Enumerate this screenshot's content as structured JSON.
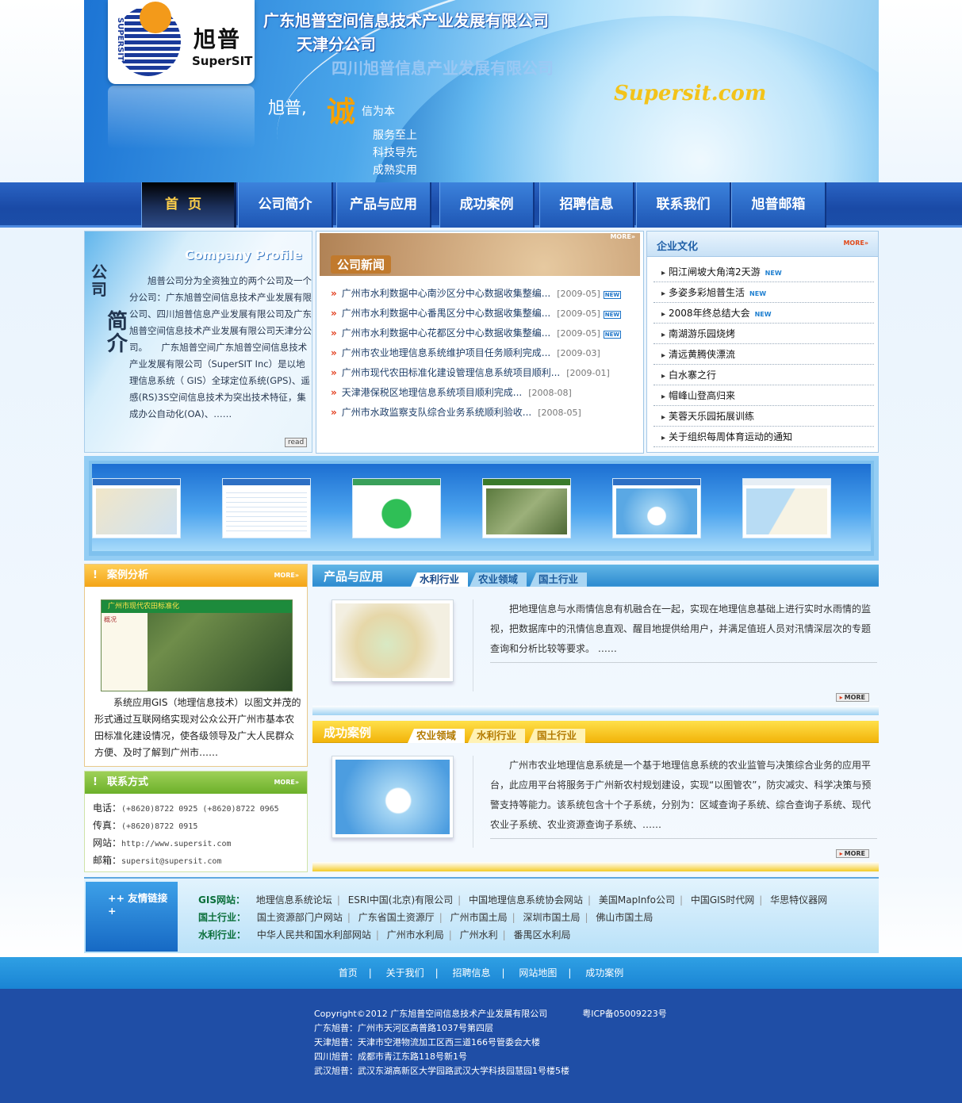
{
  "banner": {
    "company_cn1": "广东旭普空间信息技术产业发展有限公司",
    "company_cn2": "天津分公司",
    "company_cn3": "四川旭普信息产业发展有限公司",
    "logo_cn": "旭普",
    "logo_en": "SuperSIT",
    "logo_vertical": "SUPERSIT",
    "slogan_prefix": "旭普,",
    "slogan_big": "诚",
    "slogan_suffix": "信为本",
    "slogan_lines": [
      "服务至上",
      "科技导先",
      "成熟实用"
    ],
    "site": "Supersit.com"
  },
  "nav": {
    "items": [
      "首页",
      "公司简介",
      "产品与应用",
      "成功案例",
      "招聘信息",
      "联系我们",
      "旭普邮箱"
    ]
  },
  "profile": {
    "title_en": "Company Profile",
    "title_cn_small": "公司",
    "title_cn_big": "简介",
    "text": "　　旭普公司分为全资独立的两个公司及一个分公司：广东旭普空间信息技术产业发展有限公司、四川旭普信息产业发展有限公司及广东旭普空间信息技术产业发展有限公司天津分公司。　　广东旭普空间广东旭普空间信息技术产业发展有限公司（SuperSIT Inc）是以地理信息系统（ GIS）全球定位系统(GPS)、遥感(RS)3S空间信息技术为突出技术特征，集成办公自动化(OA)、……",
    "read_label": "read"
  },
  "news": {
    "title": "公司新闻",
    "more": "MORE»",
    "items": [
      {
        "title": "广州市水利数据中心南沙区分中心数据收集整编...",
        "date": "[2009-05]",
        "new": "NEW"
      },
      {
        "title": "广州市水利数据中心番禺区分中心数据收集整编...",
        "date": "[2009-05]",
        "new": "NEW"
      },
      {
        "title": "广州市水利数据中心花都区分中心数据收集整编...",
        "date": "[2009-05]",
        "new": "NEW"
      },
      {
        "title": "广州市农业地理信息系统维护项目任务顺利完成...",
        "date": "[2009-03]",
        "new": ""
      },
      {
        "title": "广州市现代农田标准化建设管理信息系统项目顺利...",
        "date": "[2009-01]",
        "new": ""
      },
      {
        "title": "天津港保税区地理信息系统项目顺利完成...",
        "date": "[2008-08]",
        "new": ""
      },
      {
        "title": "广州市水政监察支队综合业务系统顺利验收...",
        "date": "[2008-05]",
        "new": ""
      }
    ]
  },
  "culture": {
    "title": "企业文化",
    "more": "MORE»",
    "items": [
      {
        "title": "阳江闸坡大角湾2天游",
        "new": "NEW"
      },
      {
        "title": "多姿多彩旭普生活",
        "new": "NEW"
      },
      {
        "title": "2008年终总结大会",
        "new": "NEW"
      },
      {
        "title": "南湖游乐园烧烤",
        "new": ""
      },
      {
        "title": "清远黄腾侠漂流",
        "new": ""
      },
      {
        "title": "白水寨之行",
        "new": ""
      },
      {
        "title": "帽峰山登高归来",
        "new": ""
      },
      {
        "title": "芙蓉天乐园拓展训练",
        "new": ""
      },
      {
        "title": "关于组织每周体育运动的通知",
        "new": ""
      }
    ]
  },
  "cases": {
    "title": "案例分析",
    "more": "MORE»",
    "shot_title": "广州市现代农田标准化",
    "shot_side": "概况",
    "text": "系统应用GIS（地理信息技术）以图文并茂的形式通过互联网络实现对公众公开广州市基本农田标准化建设情况，使各级领导及广大人民群众方便、及时了解到广州市……"
  },
  "contact": {
    "title": "联系方式",
    "more": "MORE»",
    "tel_label": "电话：",
    "tel": "(+8620)8722 0925 (+8620)8722 0965",
    "fax_label": "传真：",
    "fax": "(+8620)8722 0915",
    "web_label": "网站：",
    "web": "http://www.supersit.com",
    "mail_label": "邮箱：",
    "mail": "supersit@supersit.com"
  },
  "products": {
    "title": "产品与应用",
    "tabs": [
      "水利行业",
      "农业领域",
      "国土行业"
    ],
    "text": "把地理信息与水雨情信息有机融合在一起，实现在地理信息基础上进行实时水雨情的监视，把数据库中的汛情信息直观、醒目地提供给用户，并满足值班人员对汛情深层次的专题查询和分析比较等要求。 ……",
    "more": "MORE"
  },
  "success": {
    "title": "成功案例",
    "tabs": [
      "农业领域",
      "水利行业",
      "国土行业"
    ],
    "text": "广州市农业地理信息系统是一个基于地理信息系统的农业监管与决策综合业务的应用平台，此应用平台将服务于广州新农村规划建设，实现“以图管农”，防灾减灾、科学决策与预警支持等能力。该系统包含十个子系统，分别为：区域查询子系统、综合查询子系统、现代农业子系统、农业资源查询子系统、……",
    "more": "MORE"
  },
  "links": {
    "title": "++ 友情链接 +",
    "rows": [
      {
        "key": "GIS网站：",
        "items": [
          "地理信息系统论坛",
          "ESRI中国(北京)有限公司",
          "中国地理信息系统协会网站",
          "美国MapInfo公司",
          "中国GIS时代网",
          "华思特仪器网"
        ]
      },
      {
        "key": "国土行业：",
        "items": [
          "国土资源部门户网站",
          "广东省国土资源厅",
          "广州市国土局",
          "深圳市国土局",
          "佛山市国土局"
        ]
      },
      {
        "key": "水利行业：",
        "items": [
          "中华人民共和国水利部网站",
          "广州市水利局",
          "广州水利",
          "番禺区水利局"
        ]
      }
    ]
  },
  "footnav": {
    "items": [
      "首页",
      "关于我们",
      "招聘信息",
      "网站地图",
      "成功案例"
    ]
  },
  "footer": {
    "copyright": "Copyright©2012 广东旭普空间信息技术产业发展有限公司",
    "icp": "粤ICP备05009223号",
    "addr1": "广东旭普：广州市天河区高普路1037号第四层",
    "addr2": "天津旭普：天津市空港物流加工区西三道166号管委会大楼",
    "addr3": "四川旭普：成都市青江东路118号新1号",
    "addr4": "武汉旭普：武汉东湖高新区大学园路武汉大学科技园慧园1号楼5楼"
  }
}
